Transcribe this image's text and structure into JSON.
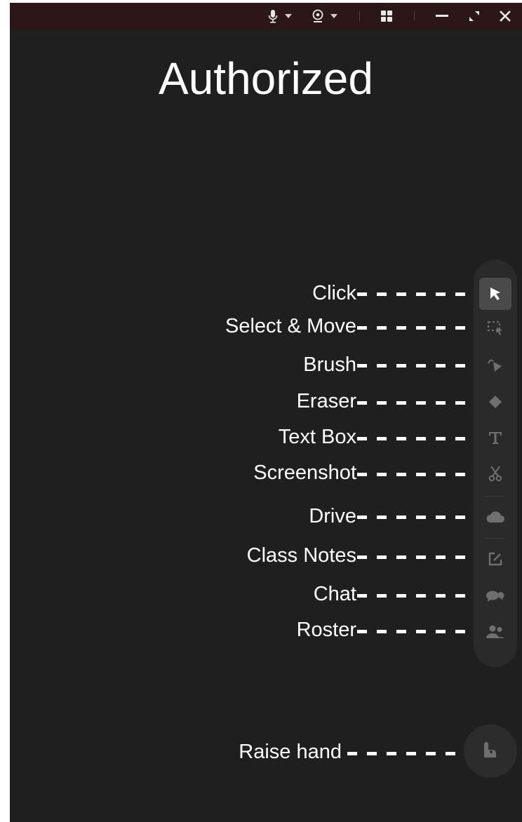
{
  "window": {
    "title": "Authorized"
  },
  "topbar": {
    "icons": [
      "microphone-icon",
      "chevron-down-icon",
      "webcam-icon",
      "chevron-down-icon",
      "layout-grid-icon",
      "minimize-icon",
      "restore-icon",
      "close-icon"
    ]
  },
  "toolbar": {
    "items": [
      {
        "label": "Click",
        "icon": "cursor-arrow-icon",
        "active": true
      },
      {
        "label": "Select & Move",
        "icon": "select-move-icon",
        "active": false
      },
      {
        "label": "Brush",
        "icon": "brush-icon",
        "active": false
      },
      {
        "label": "Eraser",
        "icon": "eraser-icon",
        "active": false
      },
      {
        "label": "Text Box",
        "icon": "text-box-icon",
        "active": false
      },
      {
        "label": "Screenshot",
        "icon": "scissors-icon",
        "active": false
      },
      {
        "label": "Drive",
        "icon": "cloud-icon",
        "active": false
      },
      {
        "label": "Class Notes",
        "icon": "edit-note-icon",
        "active": false
      },
      {
        "label": "Chat",
        "icon": "chat-bubbles-icon",
        "active": false
      },
      {
        "label": "Roster",
        "icon": "people-icon",
        "active": false
      }
    ]
  },
  "raise_hand": {
    "label": "Raise hand",
    "icon": "raise-hand-icon"
  },
  "colors": {
    "background": "#1f1f1f",
    "topbar": "#2b1816",
    "toolbar": "#2a2a2a",
    "text": "#ffffff",
    "icon": "#6f6f6f",
    "active_icon_bg": "#4a4a4a"
  }
}
